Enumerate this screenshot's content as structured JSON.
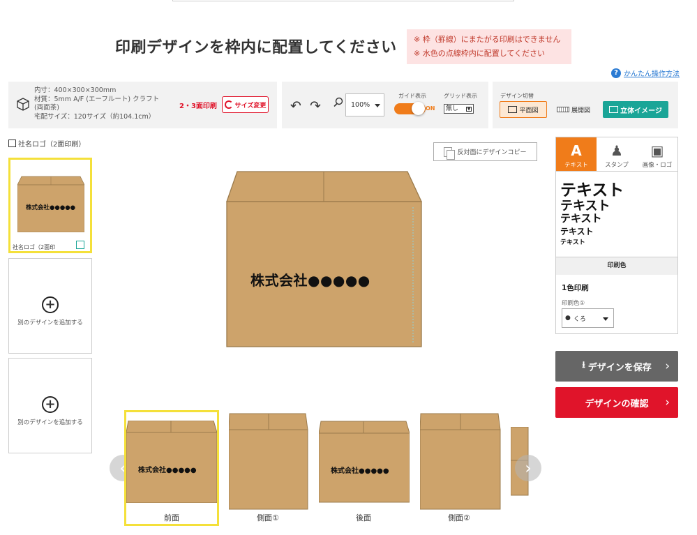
{
  "header": {
    "title": "印刷デザインを枠内に配置してください",
    "notice_line1": "※ 枠（罫線）にまたがる印刷はできません",
    "notice_line2": "※ 水色の点線枠内に配置してください",
    "howto_link": "かんたん操作方法"
  },
  "box_info": {
    "inner_size": "内寸：400×300×300mm",
    "material": "材質：5mm A/F (エーフルート) クラフト",
    "material_note": "(両面茶)",
    "shipping": "宅配サイズ：120サイズ（約104.1cm）",
    "print_type": "2・3面印刷",
    "size_change_button": "サイズ変更"
  },
  "tools": {
    "zoom_value": "100%",
    "guide_label": "ガイド表示",
    "guide_state": "ON",
    "grid_label": "グリッド表示",
    "grid_value": "無し"
  },
  "view_switch": {
    "label": "デザイン切替",
    "plane_button": "平面図",
    "unfold_button": "展開図",
    "threed_button": "立体イメージ"
  },
  "designs": {
    "section_label": "社名ロゴ（2面印刷）",
    "selected_label": "社名ロゴ（2面印",
    "thumb_text": "株式会社●●●●●",
    "add_label": "別のデザインを追加する"
  },
  "canvas": {
    "copy_button": "反対面にデザインコピー",
    "main_text": "株式会社●●●●●",
    "colors": {
      "kraft": "#cda36b",
      "edge": "#9b7b4c",
      "selection": "#f4e03a"
    }
  },
  "faces": [
    {
      "label": "前面",
      "text": "株式会社●●●●●"
    },
    {
      "label": "側面①",
      "text": ""
    },
    {
      "label": "後面",
      "text": "株式会社●●●●●"
    },
    {
      "label": "側面②",
      "text": ""
    }
  ],
  "tool_panel": {
    "tabs": [
      {
        "label": "テキスト",
        "icon": "text-icon"
      },
      {
        "label": "スタンプ",
        "icon": "stamp-icon"
      },
      {
        "label": "画像・ロゴ",
        "icon": "image-icon"
      }
    ],
    "samples": [
      "テキスト",
      "テキスト",
      "テキスト",
      "テキスト",
      "テキスト"
    ],
    "print_color_header": "印刷色",
    "color_count": "1色印刷",
    "color1_label": "印刷色①",
    "color1_value": "くろ"
  },
  "actions": {
    "save": "デザインを保存",
    "confirm": "デザインの確認"
  }
}
